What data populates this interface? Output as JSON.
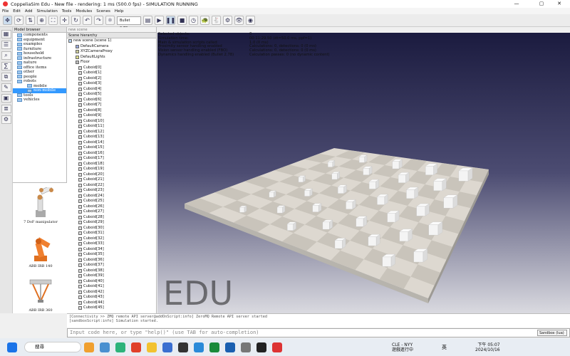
{
  "window": {
    "title": "CoppeliaSim Edu - New file - rendering: 1 ms (500.0 fps) - SIMULATION RUNNING"
  },
  "menu": [
    "File",
    "Edit",
    "Add",
    "Simulation",
    "Tools",
    "Modules",
    "Scenes",
    "Help"
  ],
  "toolbar": {
    "engine": "Bullet 2.78"
  },
  "model_browser": {
    "header": "Model browser",
    "items": [
      {
        "label": "components",
        "selected": false
      },
      {
        "label": "equipment",
        "selected": false
      },
      {
        "label": "examples",
        "selected": false
      },
      {
        "label": "furniture",
        "selected": false
      },
      {
        "label": "household",
        "selected": false
      },
      {
        "label": "infrastructure",
        "selected": false
      },
      {
        "label": "nature",
        "selected": false
      },
      {
        "label": "office items",
        "selected": false
      },
      {
        "label": "other",
        "selected": false
      },
      {
        "label": "people",
        "selected": false
      },
      {
        "label": "robots",
        "selected": false
      },
      {
        "label": "mobile",
        "selected": false
      },
      {
        "label": "non-mobile",
        "selected": true
      },
      {
        "label": "tools",
        "selected": false
      },
      {
        "label": "vehicles",
        "selected": false
      }
    ],
    "thumbnails": [
      "7 DoF manipulator",
      "ABB IRB 140",
      "ABB IRB 360"
    ]
  },
  "hierarchy": {
    "tab": "new scene",
    "header": "Scene hierarchy",
    "root": "new scene (scene 1)",
    "top_items": [
      "DefaultCamera",
      "XYZCameraProxy",
      "DefaultLights",
      "Floor"
    ],
    "cuboids": [
      "Cuboid[0]",
      "Cuboid[1]",
      "Cuboid[2]",
      "Cuboid[3]",
      "Cuboid[4]",
      "Cuboid[5]",
      "Cuboid[6]",
      "Cuboid[7]",
      "Cuboid[8]",
      "Cuboid[9]",
      "Cuboid[10]",
      "Cuboid[11]",
      "Cuboid[12]",
      "Cuboid[13]",
      "Cuboid[14]",
      "Cuboid[15]",
      "Cuboid[16]",
      "Cuboid[17]",
      "Cuboid[18]",
      "Cuboid[19]",
      "Cuboid[20]",
      "Cuboid[21]",
      "Cuboid[22]",
      "Cuboid[23]",
      "Cuboid[24]",
      "Cuboid[25]",
      "Cuboid[26]",
      "Cuboid[27]",
      "Cuboid[28]",
      "Cuboid[29]",
      "Cuboid[30]",
      "Cuboid[31]",
      "Cuboid[32]",
      "Cuboid[33]",
      "Cuboid[34]",
      "Cuboid[35]",
      "Cuboid[36]",
      "Cuboid[37]",
      "Cuboid[38]",
      "Cuboid[39]",
      "Cuboid[40]",
      "Cuboid[41]",
      "Cuboid[42]",
      "Cuboid[43]",
      "Cuboid[44]",
      "Cuboid[45]"
    ]
  },
  "sim_info": [
    {
      "k": "Selected objects:",
      "v": "0"
    },
    {
      "k": "Simulation time:",
      "v": "00:11:29.50 (dt=50.0 ms, ppf=1)"
    },
    {
      "k": "Main & simulation scripts called",
      "v": "1.0 (0 ms)"
    },
    {
      "k": "Proximity sensor handling enabled",
      "v": "Calculations: 0, detections: 0 (0 ms)"
    },
    {
      "k": "Vision sensor handling enabled (FBO)",
      "v": "Calculations: 0, detections: 0 (0 ms)"
    },
    {
      "k": "Dynamics handling enabled (Bullet 2.78)",
      "v": "Calculation passes: 0 (no dynamic content)"
    }
  ],
  "watermark": "EDU",
  "console": [
    "[Connectivity >> ZMQ remote API server@addOnScript:info] ZeroMQ Remote API server started",
    "[sandboxScript:info] Simulation started."
  ],
  "input": {
    "placeholder": "Input code here, or type \"help()\" (use TAB for auto-completion)",
    "sandbox": "Sandbox (lua)"
  },
  "taskbar": {
    "search": "搜尋",
    "weather": "CLE - NYY",
    "weather_sub": "遊戲進行中",
    "ime": "英",
    "time": "下午 05:07",
    "date": "2024/10/16"
  }
}
